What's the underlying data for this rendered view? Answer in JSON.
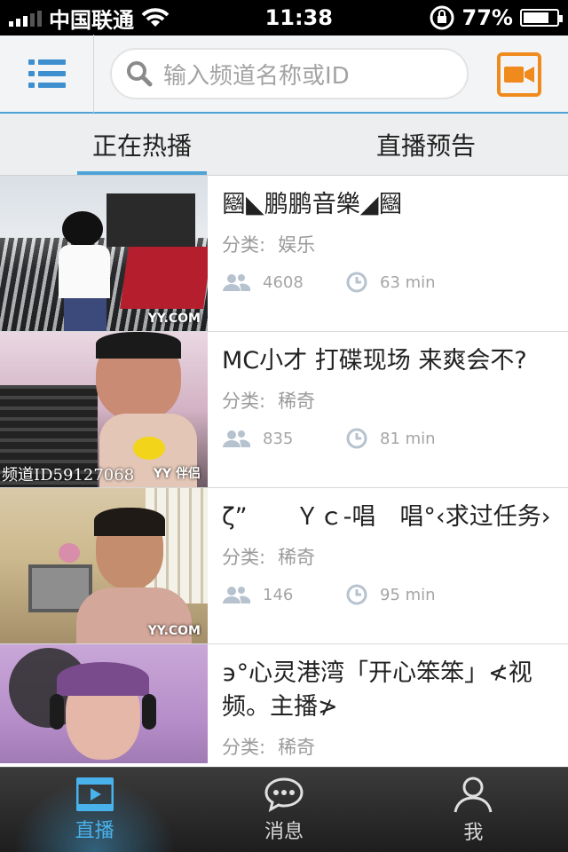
{
  "status_bar": {
    "carrier": "中国联通",
    "time": "11:38",
    "battery": "77%",
    "battery_level": 0.77
  },
  "navbar": {
    "menu_icon": "list-icon",
    "search_placeholder": "输入频道名称或ID",
    "search_icon": "search-icon",
    "camera_icon": "video-camera-icon",
    "accent_color": "#f08a1c"
  },
  "tabs": [
    {
      "label": "正在热播",
      "active": true
    },
    {
      "label": "直播预告",
      "active": false
    }
  ],
  "list": {
    "category_label": "分类:",
    "items": [
      {
        "title": "圝◣鹏鹏音樂◢圝",
        "category": "娱乐",
        "viewers": "4608",
        "duration": "63 min",
        "watermark": "YY.COM",
        "channel_id": ""
      },
      {
        "title": "MC小才 打碟现场 来爽会不?",
        "category": "稀奇",
        "viewers": "835",
        "duration": "81 min",
        "watermark": "YY 伴侣",
        "channel_id": "频道ID59127068"
      },
      {
        "title": "ζ”　　Ｙｃ-唱　唱°‹求过任务›",
        "category": "稀奇",
        "viewers": "146",
        "duration": "95 min",
        "watermark": "YY.COM",
        "channel_id": ""
      },
      {
        "title": "϶°心灵港湾「开心笨笨」≮视频。主播≯",
        "category": "稀奇",
        "viewers": "",
        "duration": "",
        "watermark": "",
        "channel_id": ""
      }
    ]
  },
  "tabbar": [
    {
      "label": "直播",
      "icon": "film-icon",
      "active": true
    },
    {
      "label": "消息",
      "icon": "chat-bubble-icon",
      "active": false
    },
    {
      "label": "我",
      "icon": "person-icon",
      "active": false
    }
  ],
  "colors": {
    "accent_blue": "#4ea3d6",
    "active_tab": "#49b2ec"
  }
}
